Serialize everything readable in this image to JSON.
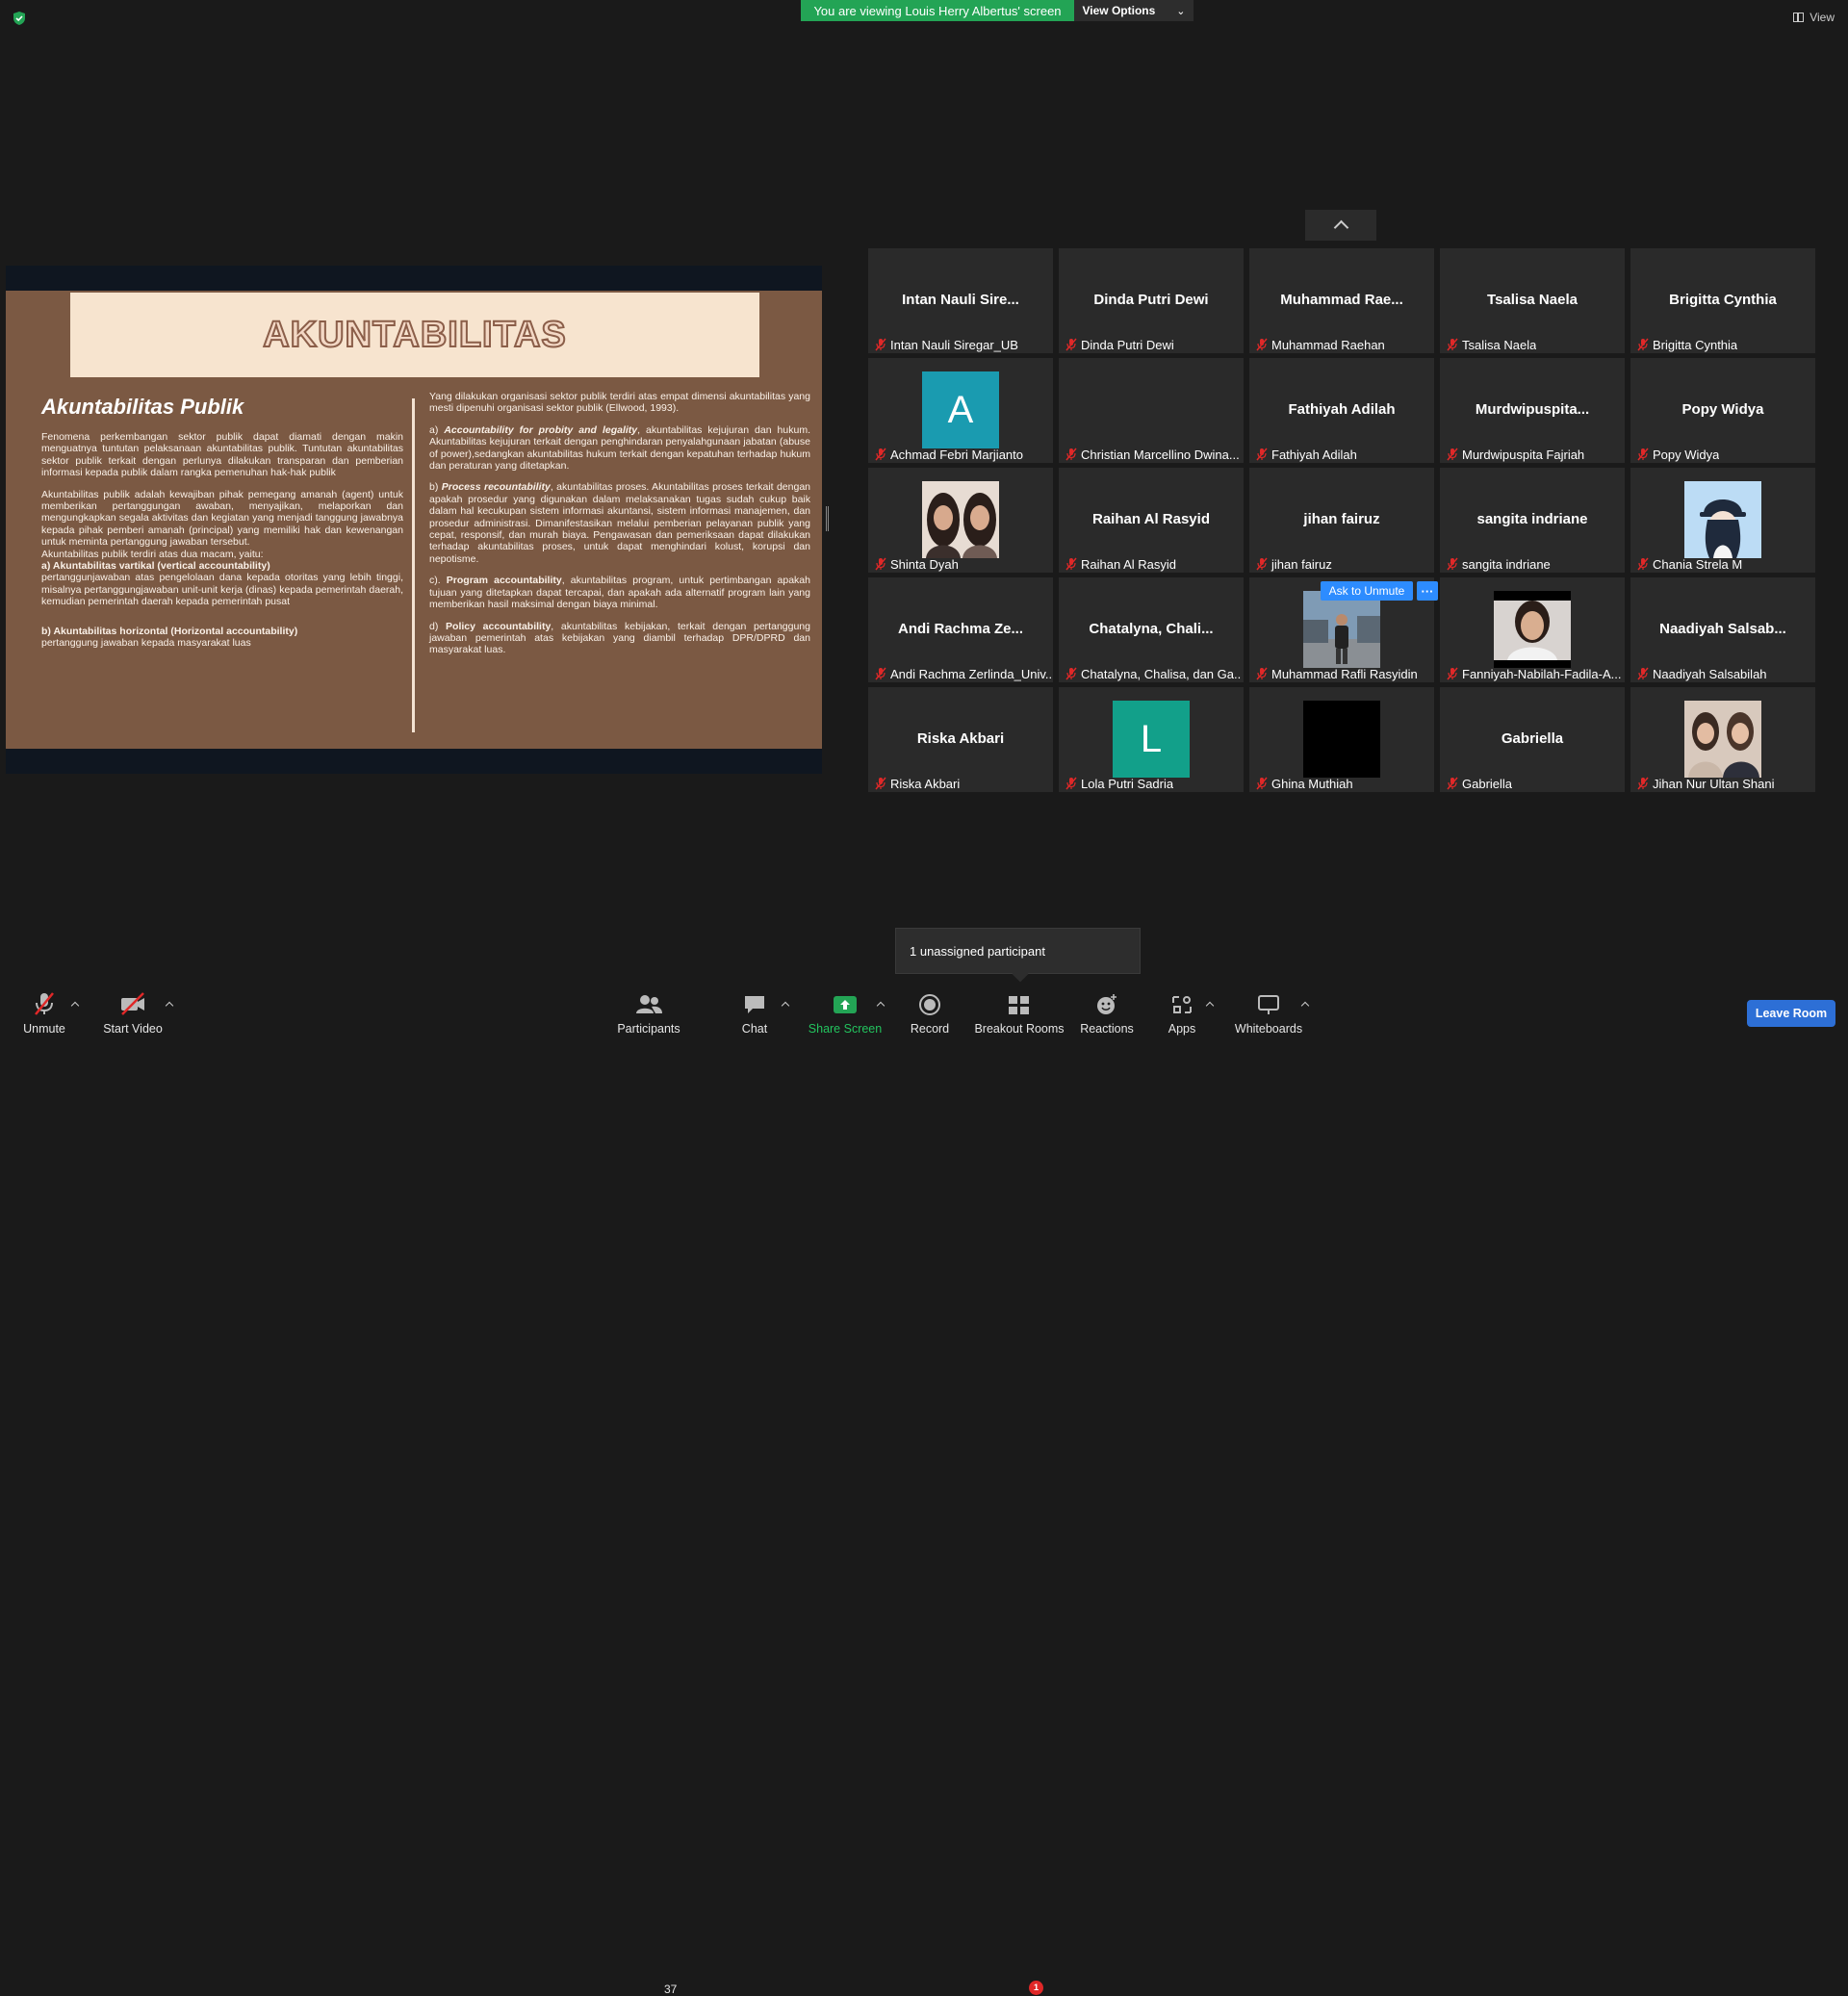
{
  "top": {
    "banner": "You are viewing Louis Herry Albertus' screen",
    "view_options": "View Options",
    "view": "View"
  },
  "slide": {
    "title": "AKUNTABILITAS",
    "subtitle": "Akuntabilitas Publik",
    "left_p1": "Fenomena perkembangan sektor publik dapat diamati dengan makin menguatnya tuntutan pelaksanaan akuntabilitas publik. Tuntutan akuntabilitas sektor publik terkait dengan perlunya dilakukan transparan dan pemberian informasi kepada publik dalam rangka pemenuhan hak-hak publik",
    "left_p2": "Akuntabilitas publik adalah kewajiban pihak pemegang amanah (agent) untuk memberikan pertanggungan awaban, menyajikan, melaporkan dan mengungkapkan segala aktivitas dan kegiatan yang menjadi tanggung jawabnya kepada pihak pemberi amanah (principal) yang memiliki hak dan kewenangan untuk meminta pertanggung jawaban tersebut.",
    "left_p3": "Akuntabilitas publik terdiri atas dua macam, yaitu:",
    "left_a_head": "a) Akuntabilitas vartikal (vertical accountability)",
    "left_a_body": "pertanggunjawaban atas pengelolaan dana kepada otoritas yang lebih tinggi, misalnya pertanggungjawaban unit-unit kerja (dinas) kepada pemerintah daerah, kemudian pemerintah daerah kepada pemerintah pusat",
    "left_b_head": "b) Akuntabilitas horizontal (Horizontal accountability)",
    "left_b_body": "pertanggung jawaban kepada masyarakat luas",
    "right_intro": "Yang dilakukan organisasi sektor publik terdiri atas empat dimensi akuntabilitas yang mesti dipenuhi organisasi sektor publik (Ellwood, 1993).",
    "right_a_pre": "a) ",
    "right_a_head": "Accountability for probity and legality",
    "right_a_body": ", akuntabilitas kejujuran dan hukum. Akuntabilitas kejujuran terkait dengan penghindaran penyalahgunaan jabatan (abuse of power),sedangkan akuntabilitas hukum terkait dengan kepatuhan terhadap hukum dan peraturan yang ditetapkan.",
    "right_b_pre": "b) ",
    "right_b_head": "Process recountability",
    "right_b_body": ", akuntabilitas proses. Akuntabilitas proses terkait dengan apakah prosedur yang digunakan dalam melaksanakan tugas sudah cukup baik dalam hal kecukupan sistem informasi akuntansi, sistem informasi manajemen, dan prosedur administrasi. Dimanifestasikan melalui pemberian pelayanan publik yang cepat, responsif, dan murah biaya. Pengawasan dan pemeriksaan dapat dilakukan terhadap akuntabilitas proses, untuk dapat menghindari kolust, korupsi dan nepotisme.",
    "right_c_pre": "c). ",
    "right_c_head": "Program accountability",
    "right_c_body": ", akuntabilitas program, untuk pertimbangan apakah tujuan yang ditetapkan dapat tercapai, dan apakah ada alternatif program lain yang memberikan hasil maksimal dengan biaya minimal.",
    "right_d_pre": "d) ",
    "right_d_head": "Policy accountability",
    "right_d_body": ", akuntabilitas kebijakan, terkait dengan pertanggung jawaban pemerintah atas kebijakan yang diambil terhadap DPR/DPRD dan masyarakat luas."
  },
  "tiles": [
    {
      "big": "Intan  Nauli  Sire...",
      "label": "Intan Nauli Siregar_UB"
    },
    {
      "big": "Dinda Putri Dewi",
      "label": "Dinda Putri Dewi"
    },
    {
      "big": "Muhammad  Rae...",
      "label": "Muhammad Raehan"
    },
    {
      "big": "Tsalisa Naela",
      "label": "Tsalisa Naela"
    },
    {
      "big": "Brigitta Cynthia",
      "label": "Brigitta Cynthia"
    },
    {
      "letter": "A",
      "color": "#1a9bb0",
      "label": "Achmad Febri Marjianto"
    },
    {
      "big": "",
      "label": "Christian Marcellino Dwina..."
    },
    {
      "big": "Fathiyah Adilah",
      "label": "Fathiyah Adilah"
    },
    {
      "big": "Murdwipuspita...",
      "label": "Murdwipuspita Fajriah"
    },
    {
      "big": "Popy Widya",
      "label": "Popy Widya"
    },
    {
      "photo": "two-women",
      "label": "Shinta Dyah"
    },
    {
      "big": "Raihan Al Rasyid",
      "label": "Raihan Al Rasyid"
    },
    {
      "big": "jihan fairuz",
      "label": "jihan fairuz"
    },
    {
      "big": "sangita indriane",
      "label": "sangita indriane"
    },
    {
      "photo": "cartoon-cap",
      "label": "Chania Strela M"
    },
    {
      "big": "Andi  Rachma  Ze...",
      "label": "Andi Rachma Zerlinda_Univ..."
    },
    {
      "big": "Chatalyna,  Chali...",
      "label": "Chatalyna, Chalisa, dan Ga..."
    },
    {
      "photo": "man-outdoor",
      "label": "Muhammad Rafli Rasyidin"
    },
    {
      "photo": "woman-smile",
      "label": "Fanniyah-Nabilah-Fadila-A..."
    },
    {
      "big": "Naadiyah  Salsab...",
      "label": "Naadiyah Salsabilah"
    },
    {
      "big": "Riska Akbari",
      "label": "Riska Akbari"
    },
    {
      "letter": "L",
      "color": "#12a08a",
      "label": "Lola Putri Sadria"
    },
    {
      "photo": "black",
      "label": "Ghina Muthiah"
    },
    {
      "big": "Gabriella",
      "label": "Gabriella"
    },
    {
      "photo": "two-girls",
      "label": "Jihan Nur Ultan Shani"
    }
  ],
  "ask_unmute": "Ask to Unmute",
  "more": "···",
  "unassigned": "1 unassigned participant",
  "toolbar": {
    "unmute": "Unmute",
    "start_video": "Start Video",
    "participants": "Participants",
    "participants_count": "37",
    "chat": "Chat",
    "share_screen": "Share Screen",
    "record": "Record",
    "breakout_rooms": "Breakout Rooms",
    "breakout_badge": "1",
    "reactions": "Reactions",
    "apps": "Apps",
    "whiteboards": "Whiteboards",
    "leave_room": "Leave Room"
  },
  "colors": {
    "share_green": "#23a455",
    "leave_blue": "#2d6fd6",
    "muted_red": "#e02828",
    "ask_blue": "#2d8cff"
  }
}
